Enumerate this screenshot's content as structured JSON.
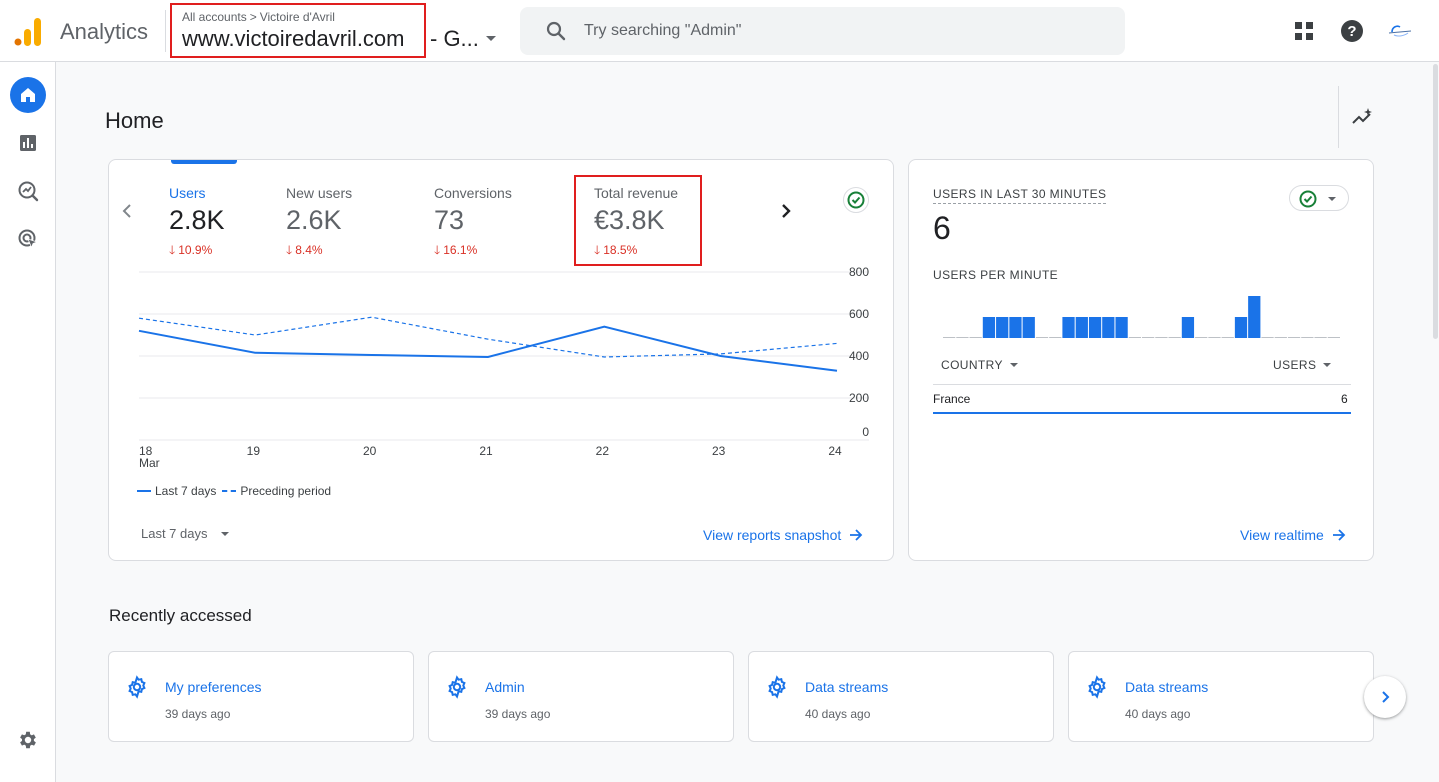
{
  "app": {
    "title": "Analytics"
  },
  "account": {
    "breadcrumb_root": "All accounts",
    "breadcrumb_account": "Victoire d'Avril",
    "property_name": "www.victoiredavril.com",
    "property_suffix": "- G..."
  },
  "search": {
    "placeholder": "Try searching \"Admin\""
  },
  "header_icons": [
    "apps-icon",
    "help-icon",
    "avatar"
  ],
  "nav": {
    "items": [
      "home-icon",
      "reports-icon",
      "explore-icon",
      "advertising-icon"
    ],
    "bottom": "admin-gear-icon"
  },
  "page": {
    "title": "Home"
  },
  "overview": {
    "metrics": [
      {
        "label": "Users",
        "value": "2.8K",
        "delta": "10.9%"
      },
      {
        "label": "New users",
        "value": "2.6K",
        "delta": "8.4%"
      },
      {
        "label": "Conversions",
        "value": "73",
        "delta": "16.1%"
      },
      {
        "label": "Total revenue",
        "value": "€3.8K",
        "delta": "18.5%"
      }
    ],
    "legend_current": "Last 7 days",
    "legend_previous": "Preceding period",
    "date_range": "Last 7 days",
    "link": "View reports snapshot"
  },
  "chart_data": {
    "type": "line",
    "categories": [
      "18\nMar",
      "19",
      "20",
      "21",
      "22",
      "23",
      "24"
    ],
    "series": [
      {
        "name": "Last 7 days",
        "style": "solid",
        "values": [
          520,
          415,
          405,
          395,
          540,
          400,
          330
        ]
      },
      {
        "name": "Preceding period",
        "style": "dashed",
        "values": [
          580,
          500,
          585,
          480,
          395,
          410,
          460
        ]
      }
    ],
    "y_ticks": [
      0,
      200,
      400,
      600,
      800
    ],
    "ylim": [
      0,
      800
    ],
    "grid": true,
    "color": "#1a73e8"
  },
  "realtime": {
    "title": "USERS IN LAST 30 MINUTES",
    "value": "6",
    "per_minute_label": "USERS PER MINUTE",
    "per_minute": [
      0,
      0,
      0,
      1,
      1,
      1,
      1,
      0,
      0,
      1,
      1,
      1,
      1,
      1,
      0,
      0,
      0,
      0,
      1,
      0,
      0,
      0,
      1,
      2,
      0,
      0,
      0,
      0,
      0,
      0
    ],
    "col_country": "COUNTRY",
    "col_users": "USERS",
    "rows": [
      {
        "country": "France",
        "users": "6"
      }
    ],
    "link": "View realtime"
  },
  "recent": {
    "title": "Recently accessed",
    "items": [
      {
        "title": "My preferences",
        "sub": "39 days ago"
      },
      {
        "title": "Admin",
        "sub": "39 days ago"
      },
      {
        "title": "Data streams",
        "sub": "40 days ago"
      },
      {
        "title": "Data streams",
        "sub": "40 days ago"
      }
    ]
  },
  "colors": {
    "accent": "#1a73e8",
    "negative": "#d93025",
    "highlight": "#e01e1e",
    "success": "#188038",
    "logo_orange": "#f9ab00",
    "logo_dark": "#e37400"
  }
}
